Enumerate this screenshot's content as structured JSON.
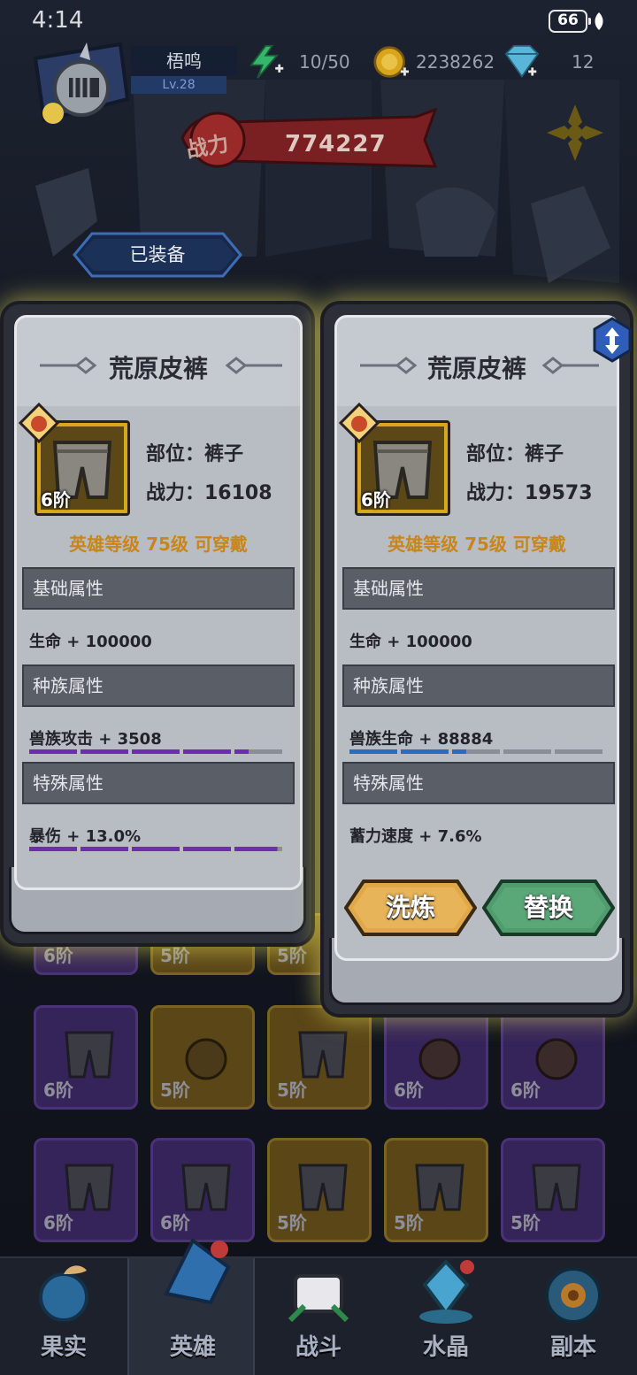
{
  "status": {
    "time": "4:14",
    "battery": "66"
  },
  "player": {
    "name": "梧鸣",
    "level": "Lv.28"
  },
  "resources": {
    "energy": "10/50",
    "gold": "2238262",
    "gems": "12"
  },
  "power": {
    "label": "战力",
    "value": "774227"
  },
  "tab": {
    "equipped": "已装备"
  },
  "cards": [
    {
      "title": "荒原皮裤",
      "tier": "6阶",
      "slot": "部位：裤子",
      "power": "战力：16108",
      "requirement": "英雄等级 75级 可穿戴",
      "basic_header": "基础属性",
      "basic_attr": "生命 + 100000",
      "race_header": "种族属性",
      "race_attr": "兽族攻击 + 3508",
      "race_bar_fill": 4.3,
      "race_bar_color": "#6a2fb0",
      "special_header": "特殊属性",
      "special_attr": "暴伤 + 13.0%",
      "special_bar_fill": 4.9,
      "special_bar_color": "#6a2fb0"
    },
    {
      "title": "荒原皮裤",
      "tier": "6阶",
      "slot": "部位：裤子",
      "power": "战力：19573",
      "requirement": "英雄等级 75级 可穿戴",
      "basic_header": "基础属性",
      "basic_attr": "生命 + 100000",
      "race_header": "种族属性",
      "race_attr": "兽族生命 + 88884",
      "race_bar_fill": 2.3,
      "race_bar_color": "#2a6cc0",
      "special_header": "特殊属性",
      "special_attr": "蓄力速度 + 7.6%",
      "refine_button": "洗炼",
      "replace_button": "替换"
    }
  ],
  "inventory": {
    "row1_tiers": [
      "6阶",
      "5阶",
      "5阶"
    ],
    "row2_tiers": [
      "6阶",
      "5阶",
      "5阶",
      "6阶",
      "6阶"
    ],
    "row3_tiers": [
      "6阶",
      "6阶",
      "5阶",
      "5阶",
      "5阶"
    ]
  },
  "nav": {
    "fruit": "果实",
    "hero": "英雄",
    "battle": "战斗",
    "crystal": "水晶",
    "dungeon": "副本"
  },
  "colors": {
    "accent_gold": "#d8a81c",
    "refine_button": "#e0a848",
    "replace_button": "#4f9c6c",
    "card_glow": "#e8dc5a"
  }
}
